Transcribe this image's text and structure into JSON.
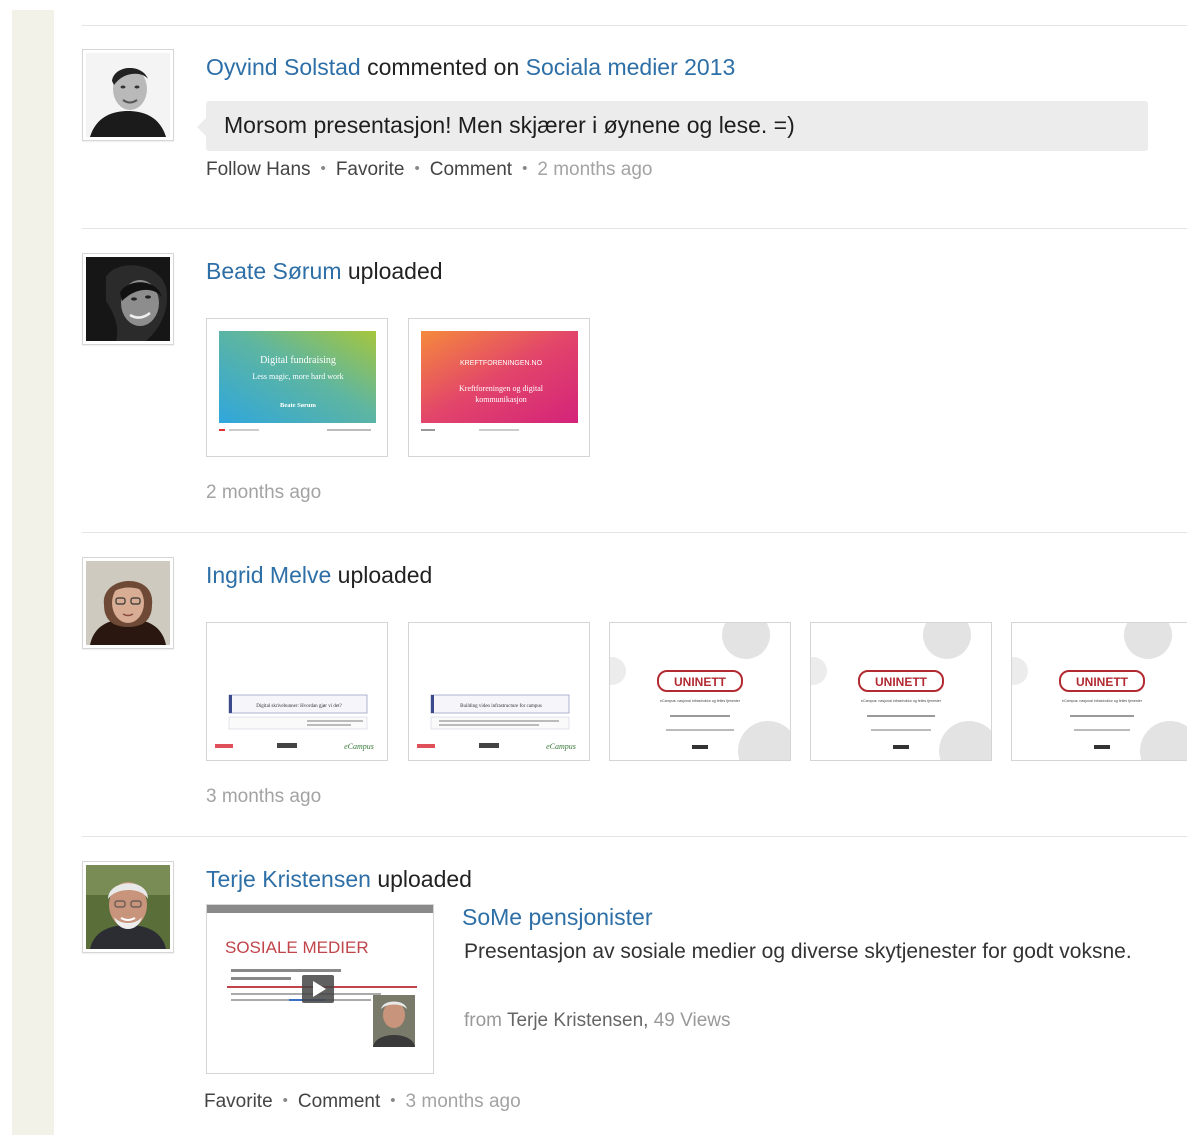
{
  "feed": {
    "items": [
      {
        "actor": "Oyvind Solstad",
        "verb": "commented on",
        "target": "Sociala medier 2013",
        "comment": "Morsom presentasjon! Men skjærer i øynene og lese. =)",
        "actions": [
          "Follow Hans",
          "Favorite",
          "Comment"
        ],
        "separator": "•",
        "time": "2 months ago"
      },
      {
        "actor": "Beate Sørum",
        "verb": "uploaded",
        "time": "2 months ago",
        "slides": [
          {
            "title": "Digital fundraising",
            "subtitle": "Less magic, more hard work",
            "author": "Beate Sørum",
            "colors": [
              "#35a9d7",
              "#97c24a"
            ]
          },
          {
            "heading": "KREFTFORENINGEN.NO",
            "subtitle_line1": "Kreftforeningen og digital",
            "subtitle_line2": "kommunikasjon",
            "colors": [
              "#f0764a",
              "#d9286f"
            ]
          }
        ]
      },
      {
        "actor": "Ingrid Melve",
        "verb": "uploaded",
        "time": "3 months ago",
        "slides": [
          {
            "title": "Digital skrivebunner: Hvordan gjør vi det?",
            "logo": "eCampus"
          },
          {
            "title": "Building video infrastructure for campus",
            "logo": "eCampus"
          },
          {
            "logo": "UNINETT",
            "caption": "eCampus: nasjonal infrastruktur og felles tjenester"
          },
          {
            "logo": "UNINETT",
            "caption": "eCampus: nasjonal infrastruktur og felles tjenester"
          },
          {
            "logo": "UNINETT",
            "caption": "eCampus: nasjonal infrastruktur og felles tjenester"
          }
        ]
      },
      {
        "actor": "Terje Kristensen",
        "verb": "uploaded",
        "deck": {
          "title": "SoMe pensjonister",
          "description": "Presentasjon av sosiale medier og diverse skytjenester for godt voksne.",
          "from_label": "from",
          "from_name": "Terje Kristensen,",
          "views": "49 Views",
          "thumbnail_title": "SOSIALE MEDIER"
        },
        "actions": [
          "Favorite",
          "Comment"
        ],
        "separator": "•",
        "time": "3 months ago"
      }
    ]
  },
  "colors": {
    "link": "#2d6fa6",
    "muted": "#a3a3a3",
    "bubble": "#ececec",
    "rail": "#f2f2e9"
  },
  "icons": [
    "play-icon"
  ]
}
